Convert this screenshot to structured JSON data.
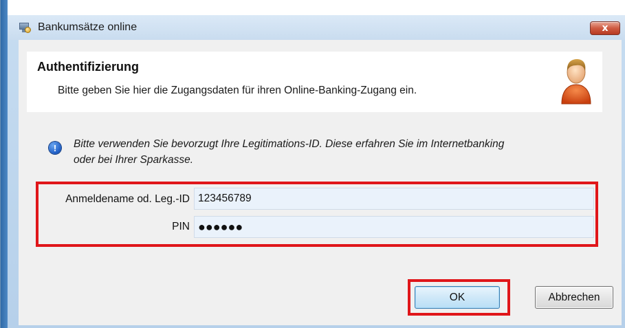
{
  "window": {
    "title": "Bankumsätze online",
    "close_glyph": "x",
    "app_icon": "bank-app-icon",
    "close_icon": "close-icon"
  },
  "header": {
    "title": "Authentifizierung",
    "description": "Bitte geben Sie hier die Zugangsdaten für ihren Online-Banking-Zugang ein.",
    "icon": "user-icon"
  },
  "info": {
    "icon": "info-icon",
    "icon_glyph": "!",
    "line1": "Bitte verwenden Sie bevorzugt Ihre Legitimations-ID. Diese erfahren Sie im Internetbanking",
    "line2": "oder bei Ihrer Sparkasse."
  },
  "form": {
    "username_label": "Anmeldename od. Leg.-ID",
    "username_value": "123456789",
    "pin_label": "PIN",
    "pin_value": "●●●●●●"
  },
  "buttons": {
    "ok_label": "OK",
    "cancel_label": "Abbrechen"
  },
  "colors": {
    "highlight": "#e0161a",
    "accent": "#3c7fb1",
    "input_bg": "#eaf2fb"
  }
}
